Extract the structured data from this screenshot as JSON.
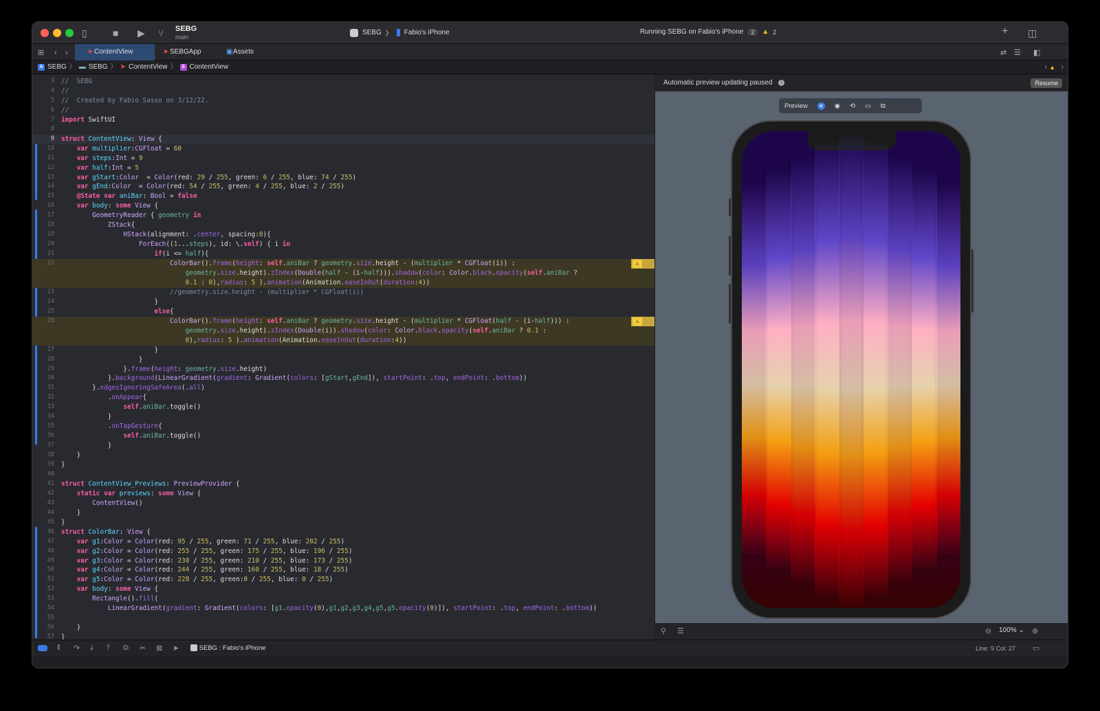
{
  "window": {
    "project_name": "SEBG",
    "branch": "main",
    "scheme": "SEBG",
    "destination": "Fabio's iPhone",
    "status": "Running SEBG on Fabio's iPhone",
    "status_badge": "2",
    "warning_count": "2"
  },
  "tabs": [
    {
      "label": "ContentView"
    },
    {
      "label": "SEBGApp"
    },
    {
      "label": "Assets"
    }
  ],
  "breadcrumb": [
    "SEBG",
    "SEBG",
    "ContentView",
    "ContentView"
  ],
  "code_lines": [
    {
      "n": "3",
      "html": "<span class='cm'>//  SEBG</span>"
    },
    {
      "n": "4",
      "html": "<span class='cm'>//</span>"
    },
    {
      "n": "5",
      "html": "<span class='cm'>//  Created by Fabio Sasso on 3/12/22.</span>"
    },
    {
      "n": "6",
      "html": "<span class='cm'>//</span>"
    },
    {
      "n": "7",
      "html": "<span class='kw'>import</span> SwiftUI"
    },
    {
      "n": "8",
      "html": ""
    },
    {
      "n": "9",
      "html": "<span class='kw'>struct</span> <span class='ty'>ContentView</span>: <span class='tp'>View</span> {",
      "cur": true
    },
    {
      "n": "10",
      "html": "    <span class='kw'>var</span> <span class='ty'>multiplier</span>:<span class='tp'>CGFloat</span> = <span class='nm'>60</span>"
    },
    {
      "n": "11",
      "html": "    <span class='kw'>var</span> <span class='ty'>steps</span>:<span class='tp'>Int</span> = <span class='nm'>9</span>"
    },
    {
      "n": "12",
      "html": "    <span class='kw'>var</span> <span class='ty'>half</span>:<span class='tp'>Int</span> = <span class='nm'>5</span>"
    },
    {
      "n": "13",
      "html": "    <span class='kw'>var</span> <span class='ty'>gStart</span>:<span class='tp'>Color</span>  = <span class='tp'>Color</span>(red: <span class='nm'>29</span> / <span class='nm'>255</span>, green: <span class='nm'>6</span> / <span class='nm'>255</span>, blue: <span class='nm'>74</span> / <span class='nm'>255</span>)"
    },
    {
      "n": "14",
      "html": "    <span class='kw'>var</span> <span class='ty'>gEnd</span>:<span class='tp'>Color</span>  = <span class='tp'>Color</span>(red: <span class='nm'>54</span> / <span class='nm'>255</span>, green: <span class='nm'>4</span> / <span class='nm'>255</span>, blue: <span class='nm'>2</span> / <span class='nm'>255</span>)"
    },
    {
      "n": "15",
      "html": "    <span class='kw'>@State</span> <span class='kw'>var</span> <span class='ty'>aniBar</span>: <span class='tp'>Bool</span> = <span class='kw'>false</span>"
    },
    {
      "n": "16",
      "html": "    <span class='kw'>var</span> <span class='ty'>body</span>: <span class='kw'>some</span> <span class='tp'>View</span> {"
    },
    {
      "n": "17",
      "html": "        <span class='tp'>GeometryReader</span> { <span class='fn'>geometry</span> <span class='kw'>in</span>"
    },
    {
      "n": "18",
      "html": "            <span class='tp'>ZStack</span>{"
    },
    {
      "n": "19",
      "html": "                <span class='tp'>HStack</span>(alignment: .<span class='pr'>center</span>, spacing:<span class='nm'>0</span>){"
    },
    {
      "n": "20",
      "html": "                    <span class='tp'>ForEach</span>((<span class='nm'>1</span>...<span class='fn'>steps</span>), id: \\.<span class='kw'>self</span>) { i <span class='kw'>in</span>"
    },
    {
      "n": "21",
      "html": "                        <span class='kw'>if</span>(i &lt;= <span class='fn'>half</span>){"
    },
    {
      "n": "22",
      "html": "                            <span class='tp'>ColorBar</span>().<span class='pr'>frame</span>(<span class='pr'>height</span>: <span class='kw'>self</span>.<span class='fn'>aniBar</span> ? <span class='fn'>geometry</span>.<span class='pr'>size</span>.height - (<span class='fn'>multiplier</span> * <span class='tp'>CGFloat</span>(i)) :",
      "warn": true
    },
    {
      "n": "",
      "html": "                                <span class='fn'>geometry</span>.<span class='pr'>size</span>.height).<span class='pr'>zIndex</span>(<span class='tp'>Double</span>(<span class='fn'>half</span> - (i-<span class='fn'>half</span>))).<span class='pr'>shadow</span>(<span class='pr'>color</span>: <span class='tp'>Color</span>.<span class='pr'>black</span>.<span class='pr'>opacity</span>(<span class='kw'>self</span>.<span class='fn'>aniBar</span> ?",
      "warn": true
    },
    {
      "n": "",
      "html": "                                <span class='nm'>0.1</span> : <span class='nm'>0</span>),<span class='pr'>radius</span>: <span class='nm'>5</span> ).<span class='pr'>animation</span>(Animation.<span class='pr'>easeInOut</span>(<span class='pr'>duration</span>:<span class='nm'>4</span>))",
      "warn": true
    },
    {
      "n": "23",
      "html": "                            <span class='cm'>//geometry.size.height - (multiplier * CGFloat(i))</span>"
    },
    {
      "n": "24",
      "html": "                        }"
    },
    {
      "n": "25",
      "html": "                        <span class='kw'>else</span>{"
    },
    {
      "n": "26",
      "html": "                            <span class='tp'>ColorBar</span>().<span class='pr'>frame</span>(<span class='pr'>height</span>: <span class='kw'>self</span>.<span class='fn'>aniBar</span> ? <span class='fn'>geometry</span>.<span class='pr'>size</span>.height - (<span class='fn'>multiplier</span> * <span class='tp'>CGFloat</span>(<span class='fn'>half</span> - (i-<span class='fn'>half</span>))) :",
      "warn": true
    },
    {
      "n": "",
      "html": "                                <span class='fn'>geometry</span>.<span class='pr'>size</span>.height).<span class='pr'>zIndex</span>(<span class='tp'>Double</span>(i)).<span class='pr'>shadow</span>(<span class='pr'>color</span>: <span class='tp'>Color</span>.<span class='pr'>black</span>.<span class='pr'>opacity</span>(<span class='kw'>self</span>.<span class='fn'>aniBar</span> ? <span class='nm'>0.1</span> :",
      "warn": true
    },
    {
      "n": "",
      "html": "                                <span class='nm'>0</span>),<span class='pr'>radius</span>: <span class='nm'>5</span> ).<span class='pr'>animation</span>(Animation.<span class='pr'>easeInOut</span>(<span class='pr'>duration</span>:<span class='nm'>4</span>))",
      "warn": true
    },
    {
      "n": "27",
      "html": "                        }"
    },
    {
      "n": "28",
      "html": "                    }"
    },
    {
      "n": "29",
      "html": "                }.<span class='pr'>frame</span>(<span class='pr'>height</span>: <span class='fn'>geometry</span>.<span class='pr'>size</span>.height)"
    },
    {
      "n": "30",
      "html": "            }.<span class='pr'>background</span>(<span class='tp'>LinearGradient</span>(<span class='pr'>gradient</span>: <span class='tp'>Gradient</span>(<span class='pr'>colors</span>: [<span class='fn'>gStart</span>,<span class='fn'>gEnd</span>]), <span class='pr'>startPoint</span>: .<span class='pr'>top</span>, <span class='pr'>endPoint</span>: .<span class='pr'>bottom</span>))"
    },
    {
      "n": "31",
      "html": "        }.<span class='pr'>edgesIgnoringSafeArea</span>(.<span class='pr'>all</span>)"
    },
    {
      "n": "32",
      "html": "            .<span class='pr'>onAppear</span>{"
    },
    {
      "n": "33",
      "html": "                <span class='kw'>self</span>.<span class='fn'>aniBar</span>.toggle()"
    },
    {
      "n": "34",
      "html": "            }"
    },
    {
      "n": "35",
      "html": "            .<span class='pr'>onTapGesture</span>{"
    },
    {
      "n": "36",
      "html": "                <span class='kw'>self</span>.<span class='fn'>aniBar</span>.toggle()"
    },
    {
      "n": "37",
      "html": "            }"
    },
    {
      "n": "38",
      "html": "    }"
    },
    {
      "n": "39",
      "html": "}"
    },
    {
      "n": "40",
      "html": ""
    },
    {
      "n": "41",
      "html": "<span class='kw'>struct</span> <span class='ty'>ContentView_Previews</span>: <span class='tp'>PreviewProvider</span> {"
    },
    {
      "n": "42",
      "html": "    <span class='kw'>static</span> <span class='kw'>var</span> <span class='ty'>previews</span>: <span class='kw'>some</span> <span class='tp'>View</span> {"
    },
    {
      "n": "43",
      "html": "        <span class='tp'>ContentView</span>()"
    },
    {
      "n": "44",
      "html": "    }"
    },
    {
      "n": "45",
      "html": "}"
    },
    {
      "n": "46",
      "html": "<span class='kw'>struct</span> <span class='ty'>ColorBar</span>: <span class='tp'>View</span> {"
    },
    {
      "n": "47",
      "html": "    <span class='kw'>var</span> <span class='ty'>g1</span>:<span class='tp'>Color</span> = <span class='tp'>Color</span>(red: <span class='nm'>95</span> / <span class='nm'>255</span>, green: <span class='nm'>71</span> / <span class='nm'>255</span>, blue: <span class='nm'>202</span> / <span class='nm'>255</span>)"
    },
    {
      "n": "48",
      "html": "    <span class='kw'>var</span> <span class='ty'>g2</span>:<span class='tp'>Color</span> = <span class='tp'>Color</span>(red: <span class='nm'>255</span> / <span class='nm'>255</span>, green: <span class='nm'>175</span> / <span class='nm'>255</span>, blue: <span class='nm'>196</span> / <span class='nm'>255</span>)"
    },
    {
      "n": "49",
      "html": "    <span class='kw'>var</span> <span class='ty'>g3</span>:<span class='tp'>Color</span> = <span class='tp'>Color</span>(red: <span class='nm'>230</span> / <span class='nm'>255</span>, green: <span class='nm'>210</span> / <span class='nm'>255</span>, blue: <span class='nm'>173</span> / <span class='nm'>255</span>)"
    },
    {
      "n": "50",
      "html": "    <span class='kw'>var</span> <span class='ty'>g4</span>:<span class='tp'>Color</span> = <span class='tp'>Color</span>(red: <span class='nm'>244</span> / <span class='nm'>255</span>, green: <span class='nm'>160</span> / <span class='nm'>255</span>, blue: <span class='nm'>18</span> / <span class='nm'>255</span>)"
    },
    {
      "n": "51",
      "html": "    <span class='kw'>var</span> <span class='ty'>g5</span>:<span class='tp'>Color</span> = <span class='tp'>Color</span>(red: <span class='nm'>228</span> / <span class='nm'>255</span>, green:<span class='nm'>0</span> / <span class='nm'>255</span>, blue: <span class='nm'>0</span> / <span class='nm'>255</span>)"
    },
    {
      "n": "52",
      "html": "    <span class='kw'>var</span> <span class='ty'>body</span>: <span class='kw'>some</span> <span class='tp'>View</span> {"
    },
    {
      "n": "53",
      "html": "        <span class='tp'>Rectangle</span>().<span class='pr'>fill</span>("
    },
    {
      "n": "54",
      "html": "            <span class='tp'>LinearGradient</span>(<span class='pr'>gradient</span>: <span class='tp'>Gradient</span>(<span class='pr'>colors</span>: [<span class='fn'>g1</span>.<span class='pr'>opacity</span>(<span class='nm'>0</span>),<span class='fn'>g1</span>,<span class='fn'>g2</span>,<span class='fn'>g3</span>,<span class='fn'>g4</span>,<span class='fn'>g5</span>,<span class='fn'>g5</span>.<span class='pr'>opacity</span>(<span class='nm'>0</span>)]), <span class='pr'>startPoint</span>: .<span class='pr'>top</span>, <span class='pr'>endPoint</span>: .<span class='pr'>bottom</span>))"
    },
    {
      "n": "55",
      "html": ""
    },
    {
      "n": "56",
      "html": "    }"
    },
    {
      "n": "57",
      "html": "}"
    }
  ],
  "preview": {
    "status_text": "Automatic preview updating paused",
    "resume_label": "Resume",
    "preview_label": "Preview",
    "zoom": "100%"
  },
  "debug": {
    "target": "SEBG : Fabio's iPhone",
    "position": "Line: 9  Col: 27"
  },
  "colors": {
    "g1": "#5f47ca",
    "g2": "#ffafc4",
    "g3": "#e6d2ad",
    "g4": "#f4a012",
    "g5": "#e40000",
    "gStart": "#1d064a",
    "gEnd": "#360402"
  },
  "bar_heights": [
    0.78,
    0.84,
    0.9,
    0.96,
    1.0,
    0.96,
    0.9,
    0.84,
    0.78
  ],
  "icons": [
    "sidebar-icon",
    "stop-icon",
    "play-icon",
    "branch-icon",
    "grid-icon",
    "back-icon",
    "forward-icon",
    "swift-icon",
    "assets-icon",
    "refresh-icon",
    "editor-options-icon",
    "inspector-icon",
    "pin-icon",
    "settings-icon",
    "zoom-out-icon",
    "zoom-in-icon",
    "breakpoint-icon",
    "pause-icon",
    "step-over-icon",
    "step-in-icon",
    "step-out-icon"
  ]
}
